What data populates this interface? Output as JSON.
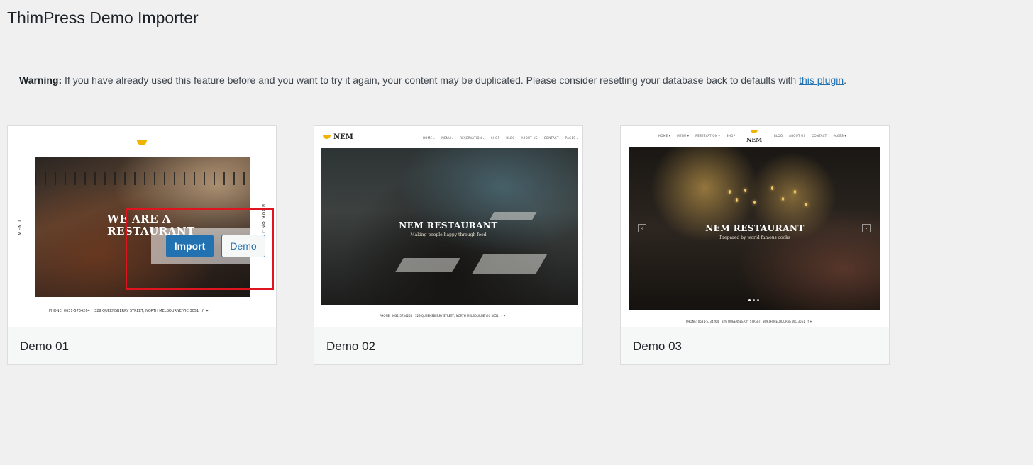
{
  "page": {
    "title": "ThimPress Demo Importer"
  },
  "warning": {
    "label": "Warning:",
    "text": " If you have already used this feature before and you want to try it again, your content may be duplicated. Please consider resetting your database back to defaults with ",
    "link_text": "this plugin",
    "suffix": "."
  },
  "demos": [
    {
      "name": "Demo 01",
      "hero_title": "WE ARE A RESTAURANT",
      "side_left": "MENU",
      "side_right": "BOOK ONLINE",
      "contact_phone": "PHONE: 0631-5734264",
      "contact_address": "329 QUEENSBERRY STREET, NORTH MELBOURNE VIC 3051",
      "import_label": "Import",
      "demo_label": "Demo"
    },
    {
      "name": "Demo 02",
      "logo_text": "NEM",
      "nav": [
        "HOME ▾",
        "MENU ▾",
        "RESERVATION ▾",
        "SHOP",
        "BLOG",
        "ABOUT US",
        "CONTACT",
        "PAGES ▾"
      ],
      "hero_title": "NEM RESTAURANT",
      "hero_subtitle": "Making people happy through food",
      "contact_phone": "PHONE: 0631-5734264",
      "contact_address": "329 QUEENSBERRY STREET, NORTH MELBOURNE VIC 3051"
    },
    {
      "name": "Demo 03",
      "logo_text": "NEM",
      "nav_left": [
        "HOME ▾",
        "MENU ▾",
        "RESERVATION ▾",
        "SHOP"
      ],
      "nav_right": [
        "BLOG",
        "ABOUT US",
        "CONTACT",
        "PAGES ▾"
      ],
      "hero_title": "NEM RESTAURANT",
      "hero_subtitle": "Prepared by world famous cooks",
      "contact_phone": "PHONE: 0631-5734264",
      "contact_address": "329 QUEENSBERRY STREET, NORTH MELBOURNE VIC 3051"
    }
  ],
  "colors": {
    "background": "#f0f0f1",
    "primary": "#2271b1",
    "highlight": "#e0141e",
    "logo": "#f0b400"
  }
}
